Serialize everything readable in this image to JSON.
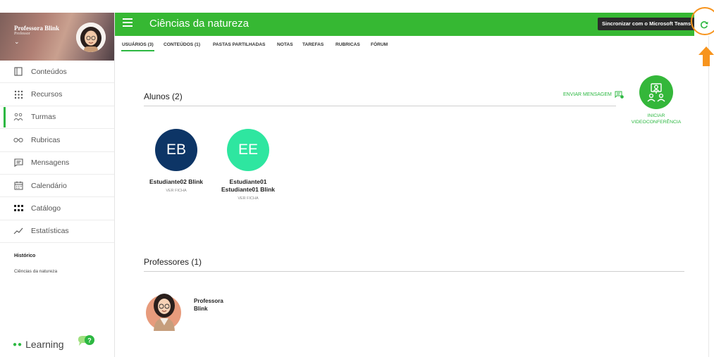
{
  "sidebar": {
    "profile": {
      "name": "Professora Blink",
      "role": "Professor",
      "chevron": "⌄"
    },
    "items": [
      {
        "label": "Conteúdos",
        "icon": "document-icon",
        "active": false
      },
      {
        "label": "Recursos",
        "icon": "grid-dots-icon",
        "active": false
      },
      {
        "label": "Turmas",
        "icon": "people-icon",
        "active": true
      },
      {
        "label": "Rubricas",
        "icon": "glasses-icon",
        "active": false
      },
      {
        "label": "Mensagens",
        "icon": "message-icon",
        "active": false
      },
      {
        "label": "Calendário",
        "icon": "calendar-icon",
        "active": false
      },
      {
        "label": "Catálogo",
        "icon": "catalog-icon",
        "active": false
      },
      {
        "label": "Estatísticas",
        "icon": "chart-line-icon",
        "active": false
      }
    ],
    "history": {
      "title": "Histórico",
      "link": "Ciências da natureza"
    },
    "brand": {
      "dots": "●●",
      "word": "Learning",
      "help_icon": "help-chat-icon"
    }
  },
  "header": {
    "menu_icon": "hamburger-icon",
    "title": "Ciências da natureza",
    "sync_tooltip": "Sincronizar com o Microsoft Teams",
    "sync_icon": "refresh-icon",
    "accent_color": "#36b833",
    "highlight_color": "#f7941d"
  },
  "tabs": [
    {
      "label": "USUÁRIOS (3)",
      "active": true
    },
    {
      "label": "CONTEÚDOS (1)",
      "active": false
    },
    {
      "label": "PASTAS PARTILHADAS",
      "active": false
    },
    {
      "label": "NOTAS",
      "active": false
    },
    {
      "label": "TAREFAS",
      "active": false
    },
    {
      "label": "RUBRICAS",
      "active": false
    },
    {
      "label": "FÓRUM",
      "active": false
    }
  ],
  "students_section": {
    "title": "Alunos (2)",
    "send_message": "ENVIAR MENSAGEM",
    "video_label_1": "INICIAR",
    "video_label_2": "VIDEOCONFERÊNCIA",
    "students": [
      {
        "initials": "EB",
        "name_1": "Estudiante02 Blink",
        "name_2": "",
        "link": "VER FICHA",
        "color": "#0d3566"
      },
      {
        "initials": "EE",
        "name_1": "Estudiante01",
        "name_2": "Estudiante01 Blink",
        "link": "VER FICHA",
        "color": "#2ee6a0"
      }
    ]
  },
  "teachers_section": {
    "title": "Professores (1)",
    "teacher": {
      "name_1": "Professora",
      "name_2": "Blink"
    }
  }
}
